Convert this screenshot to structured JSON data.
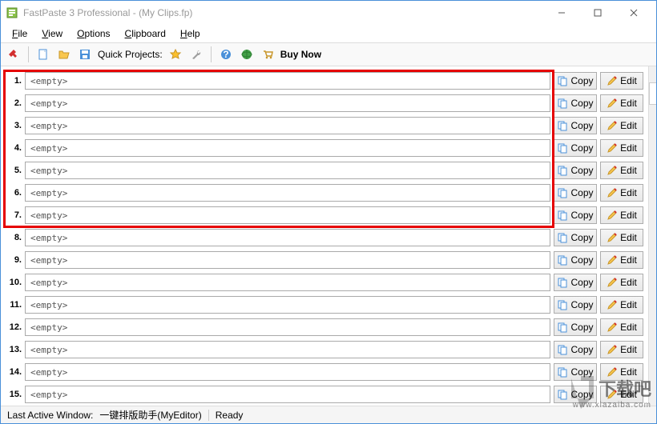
{
  "window": {
    "title": "FastPaste 3 Professional -  (My Clips.fp)"
  },
  "menu": {
    "file": "File",
    "view": "View",
    "options": "Options",
    "clipboard": "Clipboard",
    "help": "Help"
  },
  "toolbar": {
    "quick_projects": "Quick Projects:",
    "buy_now": "Buy Now"
  },
  "icons": {
    "app": "app-icon",
    "pin": "pin-icon",
    "new": "new-file-icon",
    "open": "folder-open-icon",
    "save": "save-icon",
    "star": "star-icon",
    "wrench": "wrench-icon",
    "help": "help-icon",
    "globe": "globe-icon",
    "cart": "cart-icon",
    "copy": "copy-icon",
    "edit": "edit-icon",
    "minimize": "minimize-icon",
    "maximize": "maximize-icon",
    "close": "close-icon"
  },
  "clips": [
    {
      "n": "1.",
      "value": "<empty>",
      "hl": true
    },
    {
      "n": "2.",
      "value": "<empty>",
      "hl": true
    },
    {
      "n": "3.",
      "value": "<empty>",
      "hl": true
    },
    {
      "n": "4.",
      "value": "<empty>",
      "hl": true
    },
    {
      "n": "5.",
      "value": "<empty>",
      "hl": true
    },
    {
      "n": "6.",
      "value": "<empty>",
      "hl": true
    },
    {
      "n": "7.",
      "value": "<empty>",
      "hl": true
    },
    {
      "n": "8.",
      "value": "<empty>",
      "hl": false
    },
    {
      "n": "9.",
      "value": "<empty>",
      "hl": false
    },
    {
      "n": "10.",
      "value": "<empty>",
      "hl": false
    },
    {
      "n": "11.",
      "value": "<empty>",
      "hl": false
    },
    {
      "n": "12.",
      "value": "<empty>",
      "hl": false
    },
    {
      "n": "13.",
      "value": "<empty>",
      "hl": false
    },
    {
      "n": "14.",
      "value": "<empty>",
      "hl": false
    },
    {
      "n": "15.",
      "value": "<empty>",
      "hl": false
    }
  ],
  "buttons": {
    "copy": "Copy",
    "edit": "Edit"
  },
  "status": {
    "last_active_label": "Last Active Window:",
    "last_active_value": "一键排版助手(MyEditor)",
    "ready": "Ready"
  },
  "watermark": {
    "big": "下载吧",
    "small": "www.xiazaiba.com"
  },
  "colors": {
    "highlight": "#e60000",
    "border": "#4a90d9"
  }
}
